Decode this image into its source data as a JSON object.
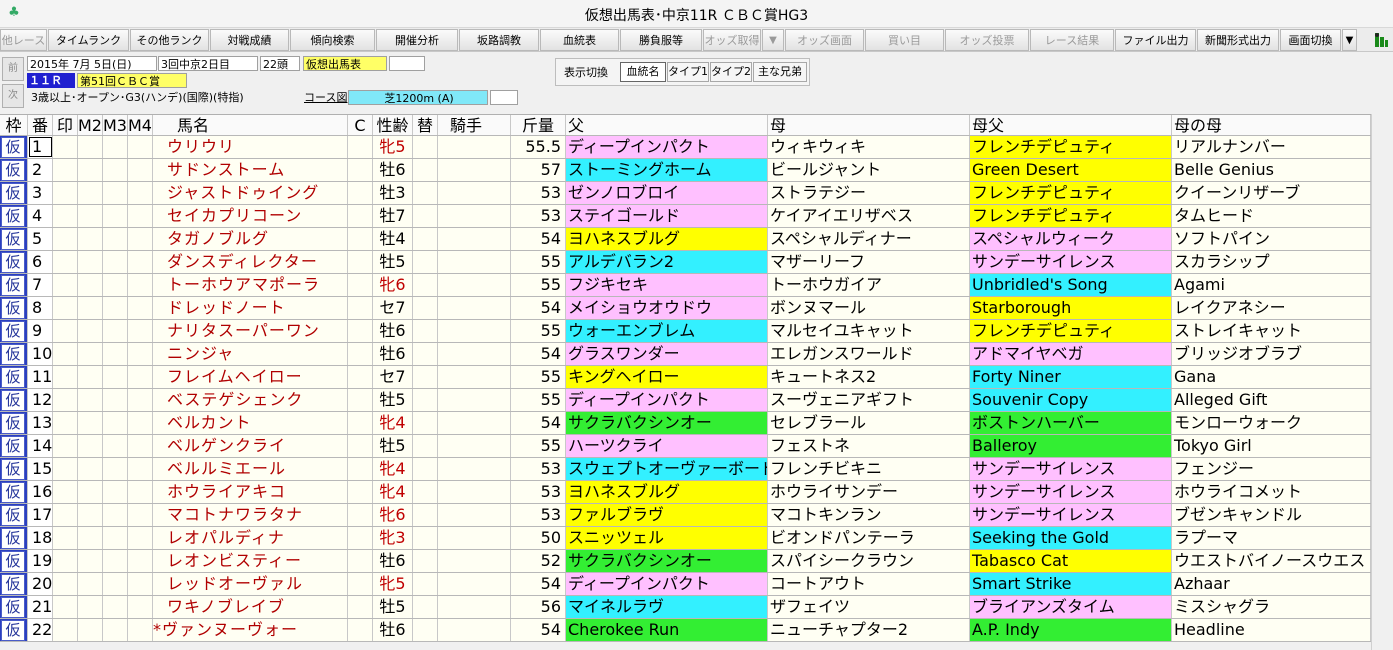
{
  "window": {
    "title": "仮想出馬表･中京11R ＣＢＣ賞HG3",
    "icon": "app-icon"
  },
  "toolbar": {
    "buttons": [
      {
        "label": "他レース",
        "enabled": false
      },
      {
        "label": "タイムランク",
        "enabled": true
      },
      {
        "label": "その他ランク",
        "enabled": true
      },
      {
        "label": "対戦成績",
        "enabled": true
      },
      {
        "label": "傾向検索",
        "enabled": true
      },
      {
        "label": "開催分析",
        "enabled": true
      },
      {
        "label": "坂路調教",
        "enabled": true
      },
      {
        "label": "血統表",
        "enabled": true
      },
      {
        "label": "勝負服等",
        "enabled": true
      },
      {
        "label": "オッズ取得",
        "enabled": false
      },
      {
        "label": "▼",
        "enabled": false
      },
      {
        "label": "オッズ画面",
        "enabled": false
      },
      {
        "label": "買い目",
        "enabled": false
      },
      {
        "label": "オッズ投票",
        "enabled": false
      },
      {
        "label": "レース結果",
        "enabled": false
      },
      {
        "label": "ファイル出力",
        "enabled": true
      },
      {
        "label": "新聞形式出力",
        "enabled": true
      },
      {
        "label": "画面切換",
        "enabled": true
      },
      {
        "label": "▼",
        "enabled": true
      }
    ],
    "right_icon": "signal-flag-icon"
  },
  "side_buttons": [
    "前",
    "次"
  ],
  "race": {
    "date": "2015年 7月 5日(日)",
    "meeting": "3回中京2日目",
    "count": "22頭",
    "mode": "仮想出馬表",
    "race_no": "１１Ｒ",
    "race_name": "第51回ＣＢＣ賞",
    "conditions": "3歳以上･オープン･G3(ハンデ)(国際)(特指)",
    "course_label": "コース図",
    "course": "芝1200m (A)"
  },
  "display_switch": {
    "label": "表示切換",
    "buttons": [
      {
        "label": "血統名",
        "active": true
      },
      {
        "label": "タイプ1",
        "active": false
      },
      {
        "label": "タイプ2",
        "active": false
      },
      {
        "label": "主な兄弟",
        "active": false
      }
    ]
  },
  "columns": {
    "waku": "枠",
    "ban": "番",
    "mark": "印",
    "m2": "M2",
    "m3": "M3",
    "m4": "M4",
    "name": "馬名",
    "c": "C",
    "sex_age": "性齢",
    "change": "替",
    "jockey": "騎手",
    "weight": "斤量",
    "sire": "父",
    "dam": "母",
    "bms": "母父",
    "damdam": "母の母"
  },
  "colors": {
    "pink": "#ffc0ff",
    "cyan": "#33f0ff",
    "yellow": "#ffff00",
    "green": "#33ee33",
    "waku_blue": "#2a3fc0",
    "name_red": "#b00000"
  },
  "horses": [
    {
      "waku": "仮",
      "ban": "1",
      "name": "ウリウリ",
      "sex_age": "牝5",
      "female": true,
      "weight": "55.5",
      "sire": "ディープインパクト",
      "sire_color": "pink",
      "dam": "ウィキウィキ",
      "bms": "フレンチデピュティ",
      "bms_color": "yellow",
      "damdam": "リアルナンバー"
    },
    {
      "waku": "仮",
      "ban": "2",
      "name": "サドンストーム",
      "sex_age": "牡6",
      "female": false,
      "weight": "57",
      "sire": "ストーミングホーム",
      "sire_color": "cyan",
      "dam": "ビールジャント",
      "bms": "Green Desert",
      "bms_color": "yellow",
      "damdam": "Belle Genius"
    },
    {
      "waku": "仮",
      "ban": "3",
      "name": "ジャストドゥイング",
      "sex_age": "牡3",
      "female": false,
      "weight": "53",
      "sire": "ゼンノロブロイ",
      "sire_color": "pink",
      "dam": "ストラテジー",
      "bms": "フレンチデピュティ",
      "bms_color": "yellow",
      "damdam": "クイーンリザーブ"
    },
    {
      "waku": "仮",
      "ban": "4",
      "name": "セイカプリコーン",
      "sex_age": "牡7",
      "female": false,
      "weight": "53",
      "sire": "ステイゴールド",
      "sire_color": "pink",
      "dam": "ケイアイエリザベス",
      "bms": "フレンチデピュティ",
      "bms_color": "yellow",
      "damdam": "タムヒード"
    },
    {
      "waku": "仮",
      "ban": "5",
      "name": "タガノブルグ",
      "sex_age": "牡4",
      "female": false,
      "weight": "54",
      "sire": "ヨハネスブルグ",
      "sire_color": "yellow",
      "dam": "スペシャルディナー",
      "bms": "スペシャルウィーク",
      "bms_color": "pink",
      "damdam": "ソフトパイン"
    },
    {
      "waku": "仮",
      "ban": "6",
      "name": "ダンスディレクター",
      "sex_age": "牡5",
      "female": false,
      "weight": "55",
      "sire": "アルデバラン2",
      "sire_color": "cyan",
      "dam": "マザーリーフ",
      "bms": "サンデーサイレンス",
      "bms_color": "pink",
      "damdam": "スカラシップ"
    },
    {
      "waku": "仮",
      "ban": "7",
      "name": "トーホウアマポーラ",
      "sex_age": "牝6",
      "female": true,
      "weight": "55",
      "sire": "フジキセキ",
      "sire_color": "pink",
      "dam": "トーホウガイア",
      "bms": "Unbridled's Song",
      "bms_color": "cyan",
      "damdam": "Agami"
    },
    {
      "waku": "仮",
      "ban": "8",
      "name": "ドレッドノート",
      "sex_age": "セ7",
      "female": false,
      "weight": "54",
      "sire": "メイショウオウドウ",
      "sire_color": "pink",
      "dam": "ボンヌマール",
      "bms": "Starborough",
      "bms_color": "yellow",
      "damdam": "レイクアネシー"
    },
    {
      "waku": "仮",
      "ban": "9",
      "name": "ナリタスーパーワン",
      "sex_age": "牡6",
      "female": false,
      "weight": "55",
      "sire": "ウォーエンブレム",
      "sire_color": "cyan",
      "dam": "マルセイユキャット",
      "bms": "フレンチデピュティ",
      "bms_color": "yellow",
      "damdam": "ストレイキャット"
    },
    {
      "waku": "仮",
      "ban": "10",
      "name": "ニンジャ",
      "sex_age": "牡6",
      "female": false,
      "weight": "54",
      "sire": "グラスワンダー",
      "sire_color": "pink",
      "dam": "エレガンスワールド",
      "bms": "アドマイヤベガ",
      "bms_color": "pink",
      "damdam": "ブリッジオブラブ"
    },
    {
      "waku": "仮",
      "ban": "11",
      "name": "フレイムヘイロー",
      "sex_age": "セ7",
      "female": false,
      "weight": "55",
      "sire": "キングヘイロー",
      "sire_color": "yellow",
      "dam": "キュートネス2",
      "bms": "Forty Niner",
      "bms_color": "cyan",
      "damdam": "Gana"
    },
    {
      "waku": "仮",
      "ban": "12",
      "name": "ベステゲシェンク",
      "sex_age": "牡5",
      "female": false,
      "weight": "55",
      "sire": "ディープインパクト",
      "sire_color": "pink",
      "dam": "スーヴェニアギフト",
      "bms": "Souvenir Copy",
      "bms_color": "cyan",
      "damdam": "Alleged Gift"
    },
    {
      "waku": "仮",
      "ban": "13",
      "name": "ベルカント",
      "sex_age": "牝4",
      "female": true,
      "weight": "54",
      "sire": "サクラバクシンオー",
      "sire_color": "green",
      "dam": "セレブラール",
      "bms": "ボストンハーバー",
      "bms_color": "green",
      "damdam": "モンローウォーク"
    },
    {
      "waku": "仮",
      "ban": "14",
      "name": "ベルゲンクライ",
      "sex_age": "牡5",
      "female": false,
      "weight": "55",
      "sire": "ハーツクライ",
      "sire_color": "pink",
      "dam": "フェストネ",
      "bms": "Balleroy",
      "bms_color": "green",
      "damdam": "Tokyo Girl"
    },
    {
      "waku": "仮",
      "ban": "15",
      "name": "ベルルミエール",
      "sex_age": "牝4",
      "female": true,
      "weight": "53",
      "sire": "スウェプトオーヴァーボード",
      "sire_color": "cyan",
      "dam": "フレンチビキニ",
      "bms": "サンデーサイレンス",
      "bms_color": "pink",
      "damdam": "フェンジー"
    },
    {
      "waku": "仮",
      "ban": "16",
      "name": "ホウライアキコ",
      "sex_age": "牝4",
      "female": true,
      "weight": "53",
      "sire": "ヨハネスブルグ",
      "sire_color": "yellow",
      "dam": "ホウライサンデー",
      "bms": "サンデーサイレンス",
      "bms_color": "pink",
      "damdam": "ホウライコメット"
    },
    {
      "waku": "仮",
      "ban": "17",
      "name": "マコトナワラタナ",
      "sex_age": "牝6",
      "female": true,
      "weight": "53",
      "sire": "ファルブラヴ",
      "sire_color": "yellow",
      "dam": "マコトキンラン",
      "bms": "サンデーサイレンス",
      "bms_color": "pink",
      "damdam": "ブゼンキャンドル"
    },
    {
      "waku": "仮",
      "ban": "18",
      "name": "レオパルディナ",
      "sex_age": "牝3",
      "female": true,
      "weight": "50",
      "sire": "スニッツェル",
      "sire_color": "yellow",
      "dam": "ビオンドパンテーラ",
      "bms": "Seeking the Gold",
      "bms_color": "cyan",
      "damdam": "ラプーマ"
    },
    {
      "waku": "仮",
      "ban": "19",
      "name": "レオンビスティー",
      "sex_age": "牡6",
      "female": false,
      "weight": "52",
      "sire": "サクラバクシンオー",
      "sire_color": "green",
      "dam": "スパイシークラウン",
      "bms": "Tabasco Cat",
      "bms_color": "yellow",
      "damdam": "ウエストバイノースウエスト"
    },
    {
      "waku": "仮",
      "ban": "20",
      "name": "レッドオーヴァル",
      "sex_age": "牝5",
      "female": true,
      "weight": "54",
      "sire": "ディープインパクト",
      "sire_color": "pink",
      "dam": "コートアウト",
      "bms": "Smart Strike",
      "bms_color": "cyan",
      "damdam": "Azhaar"
    },
    {
      "waku": "仮",
      "ban": "21",
      "name": "ワキノブレイブ",
      "sex_age": "牡5",
      "female": false,
      "weight": "56",
      "sire": "マイネルラヴ",
      "sire_color": "cyan",
      "dam": "ザフェイツ",
      "bms": "ブライアンズタイム",
      "bms_color": "pink",
      "damdam": "ミスシャグラ"
    },
    {
      "waku": "仮",
      "ban": "22",
      "name": "*ヴァンヌーヴォー",
      "sex_age": "牡6",
      "female": false,
      "weight": "54",
      "sire": "Cherokee Run",
      "sire_color": "green",
      "dam": "ニューチャプター2",
      "bms": "A.P. Indy",
      "bms_color": "green",
      "damdam": "Headline"
    }
  ]
}
